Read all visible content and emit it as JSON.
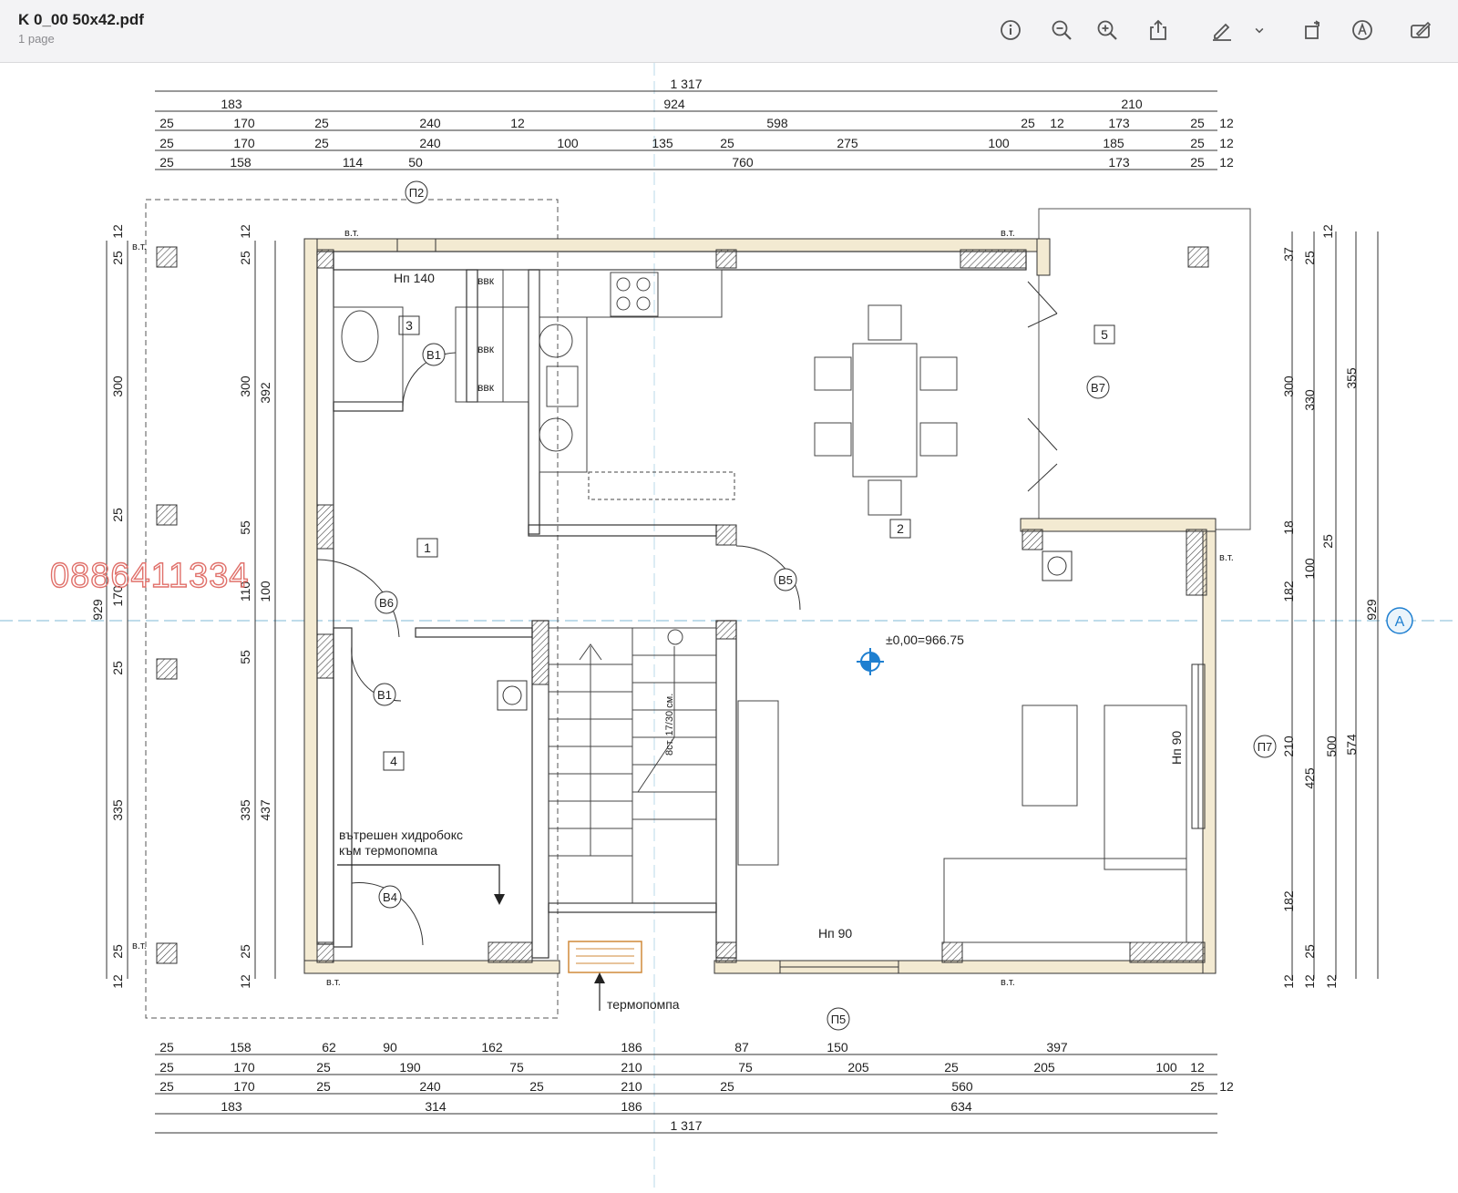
{
  "toolbar": {
    "title": "K 0_00 50x42.pdf",
    "subtitle": "1 page",
    "buttons": [
      {
        "name": "info-button",
        "icon": "info-icon"
      },
      {
        "name": "zoom-out-button",
        "icon": "zoom-out-icon"
      },
      {
        "name": "zoom-in-button",
        "icon": "zoom-in-icon"
      },
      {
        "name": "share-button",
        "icon": "share-icon"
      },
      {
        "name": "markup-button",
        "icon": "pencil-icon"
      },
      {
        "name": "markup-menu-button",
        "icon": "chevron-down-icon"
      },
      {
        "name": "rotate-button",
        "icon": "rotate-icon"
      },
      {
        "name": "signature-button",
        "icon": "pen-circle-icon"
      },
      {
        "name": "edit-button",
        "icon": "edit-icon"
      }
    ]
  },
  "plan": {
    "watermark": "0886411334",
    "elevation": "±0,00=966.75",
    "section_mark": "A",
    "top_dims": {
      "total": "1 317",
      "row1": [
        "183",
        "924",
        "210"
      ],
      "row2": [
        "25",
        "170",
        "25",
        "240",
        "12",
        "598",
        "25",
        "12",
        "173",
        "25",
        "12"
      ],
      "row3": [
        "25",
        "170",
        "25",
        "240",
        "100",
        "135",
        "25",
        "275",
        "100",
        "185",
        "25",
        "12"
      ],
      "row4": [
        "25",
        "158",
        "114",
        "50",
        "760",
        "173",
        "25",
        "12"
      ]
    },
    "bottom_dims": {
      "row1": [
        "25",
        "158",
        "62",
        "90",
        "162",
        "186",
        "87",
        "150",
        "397"
      ],
      "row2": [
        "25",
        "170",
        "25",
        "190",
        "75",
        "210",
        "75",
        "205",
        "25",
        "205",
        "100",
        "12"
      ],
      "row3": [
        "25",
        "170",
        "25",
        "240",
        "25",
        "210",
        "25",
        "560",
        "25",
        "12"
      ],
      "row4": [
        "183",
        "314",
        "186",
        "634"
      ],
      "total": "1 317"
    },
    "left_dims": [
      "12",
      "25",
      "300",
      "25",
      "170",
      "25",
      "335",
      "25",
      "12",
      "929"
    ],
    "left_inner_dims": [
      "12",
      "25",
      "300",
      "392",
      "55",
      "110",
      "100",
      "55",
      "335",
      "437",
      "25",
      "12"
    ],
    "right_dims": [
      "37",
      "25",
      "12",
      "300",
      "330",
      "355",
      "18",
      "182",
      "25",
      "100",
      "210",
      "425",
      "182",
      "25",
      "12",
      "500",
      "574",
      "929",
      "12",
      "12"
    ],
    "rooms": [
      "1",
      "2",
      "3",
      "4",
      "5"
    ],
    "openings": {
      "p2": "П2",
      "p5": "П5",
      "p7": "П7",
      "b1": "В1",
      "b4": "В4",
      "b5": "В5",
      "b6": "В6",
      "b7": "В7"
    },
    "labels": {
      "np140": "Нп 140",
      "np90_bottom": "Нп 90",
      "np90_right": "Нп 90",
      "vvk": "ввк",
      "vt": "в.т.",
      "hydrobox_1": "вътрешен хидробокс",
      "hydrobox_2": "към термопомпа",
      "heatpump": "термопомпа",
      "stairs": "8ст. 17/30 см."
    }
  }
}
